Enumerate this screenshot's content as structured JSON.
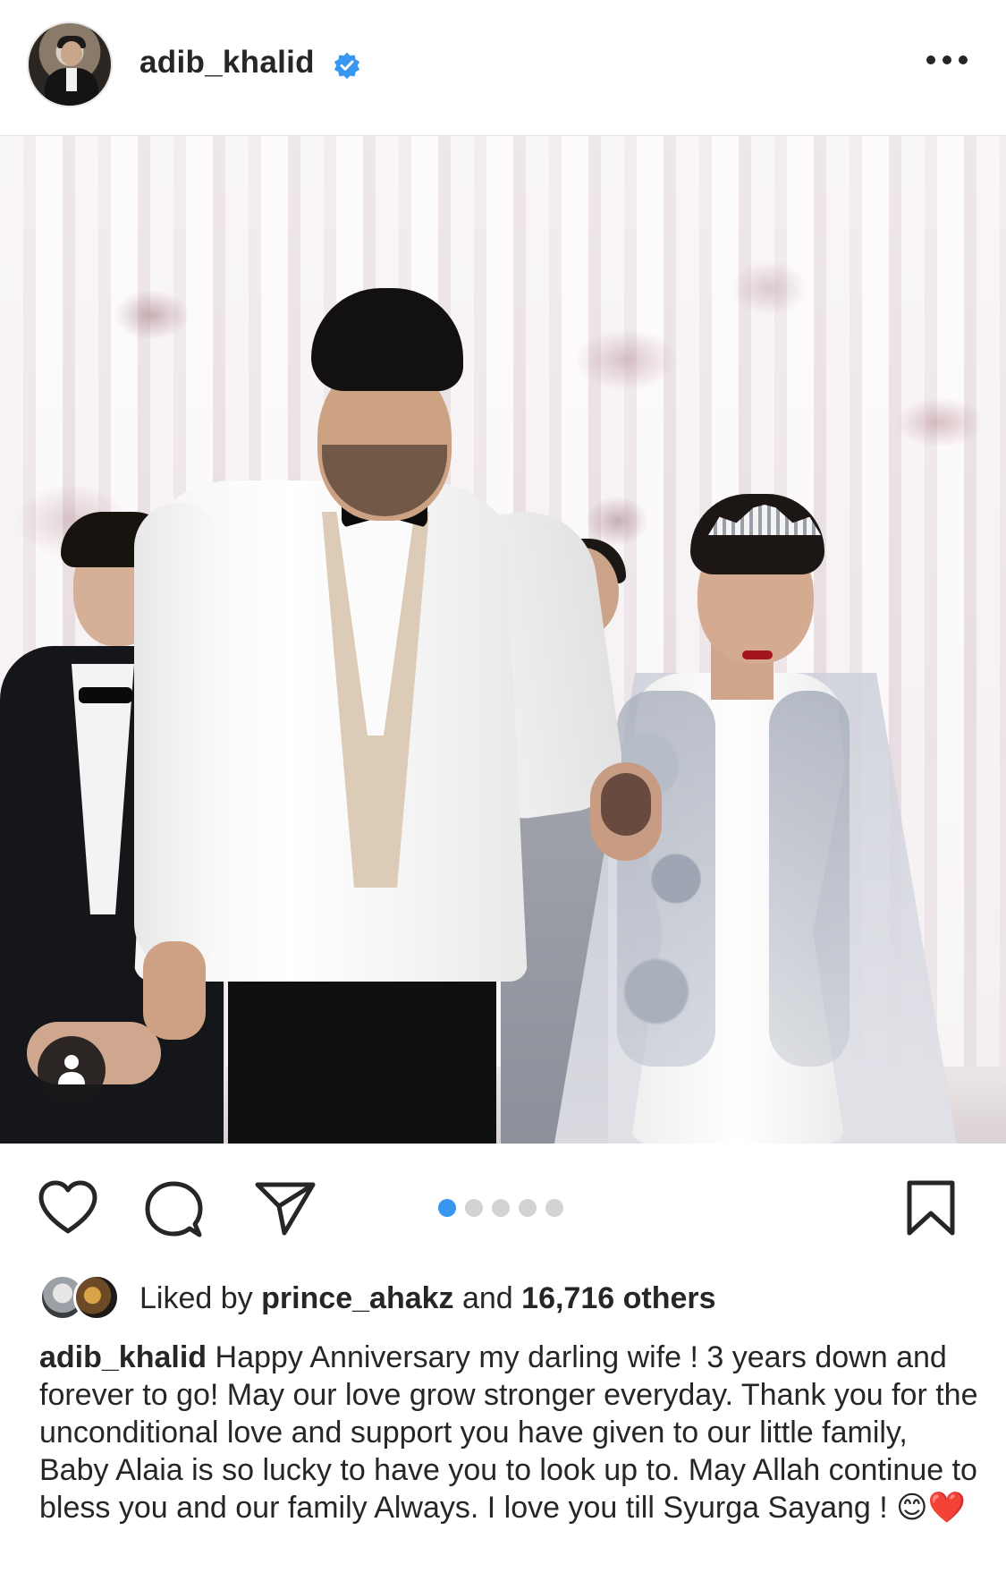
{
  "post": {
    "username": "adib_khalid",
    "verified": true
  },
  "media": {
    "carousel_count": 5,
    "carousel_active_index": 0,
    "has_tagged_users": true
  },
  "likes": {
    "prefix": "Liked by ",
    "liker": "prince_ahakz",
    "joiner": " and ",
    "others": "16,716 others"
  },
  "caption": {
    "username": "adib_khalid",
    "text": " Happy Anniversary my darling wife ! 3 years down and forever to go! May our love grow stronger everyday. Thank you for the unconditional love and support you have given to our little family, Baby Alaia is so lucky to have you to look up to. May Allah continue to bless you and our family Always. I love you till Syurga Sayang ! ",
    "emoji_1": "😊",
    "emoji_2": "❤️"
  },
  "colors": {
    "accent": "#3897f0",
    "text": "#262626",
    "dot_inactive": "#d3d3d3"
  },
  "icons": [
    "more-icon",
    "verified-badge-icon",
    "user-tag-icon",
    "heart-icon",
    "comment-icon",
    "share-icon",
    "bookmark-icon"
  ]
}
